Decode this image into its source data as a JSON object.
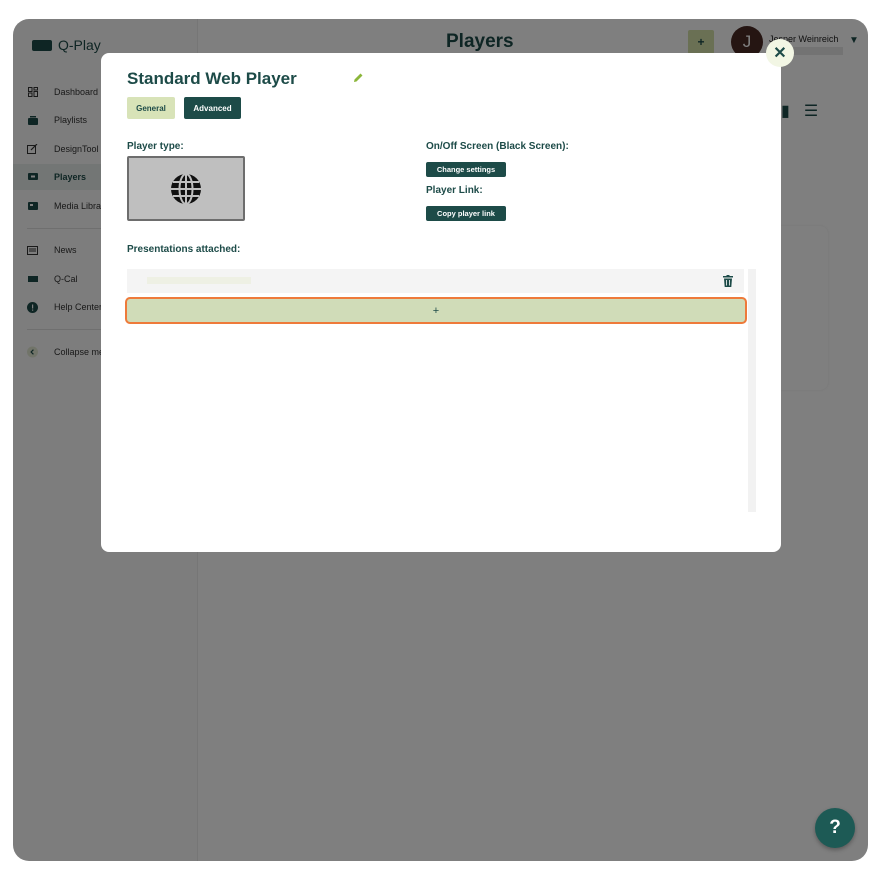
{
  "app": {
    "logo_text": "Q-Play",
    "page_title": "Players",
    "add_label": "+",
    "help_label": "?"
  },
  "user": {
    "initial": "J",
    "name": "Jesper Weinreich"
  },
  "sidebar": {
    "items": [
      {
        "label": "Dashboard",
        "icon": "grid-icon"
      },
      {
        "label": "Playlists",
        "icon": "playlist-icon"
      },
      {
        "label": "DesignTool",
        "icon": "design-icon"
      },
      {
        "label": "Players",
        "icon": "player-icon",
        "active": true
      },
      {
        "label": "Media Library",
        "icon": "media-icon"
      },
      {
        "label": "News",
        "icon": "news-icon"
      },
      {
        "label": "Q-Cal",
        "icon": "calendar-icon"
      },
      {
        "label": "Help Center",
        "icon": "help-icon"
      },
      {
        "label": "Collapse menu",
        "icon": "chevron-left-icon"
      }
    ]
  },
  "modal": {
    "title": "Standard Web Player",
    "close_label": "✕",
    "tabs": {
      "general": "General",
      "advanced": "Advanced"
    },
    "player_type_label": "Player type:",
    "player_type_icon": "globe-icon",
    "onoff_label": "On/Off Screen (Black Screen):",
    "change_settings_label": "Change settings",
    "player_link_label": "Player Link:",
    "copy_link_label": "Copy player link",
    "presentations_label": "Presentations attached:",
    "add_presentation_label": "+"
  },
  "colors": {
    "primary": "#1d4b48",
    "accent": "#d8e3b8",
    "focus": "#ee7a3a"
  }
}
